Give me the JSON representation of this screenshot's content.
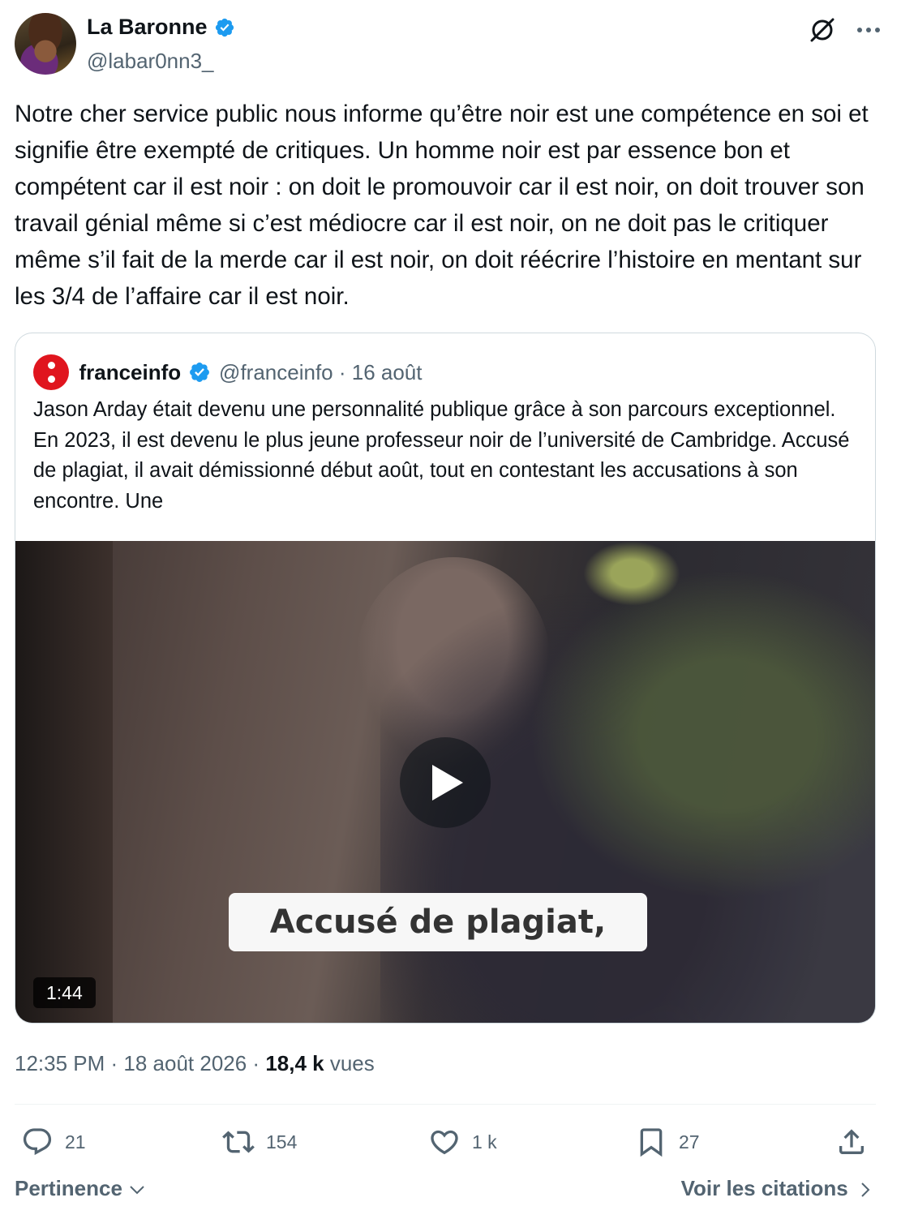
{
  "author": {
    "name": "La Baronne",
    "handle": "@labar0nn3_"
  },
  "tweet": {
    "text": "Notre cher service public nous informe qu’être noir est une compétence en soi et signifie être exempté de critiques. Un homme noir est par essence bon et compétent car il est noir : on doit le promouvoir car il est noir, on doit trouver son travail génial même si c’est médiocre car il est noir, on ne doit pas le critiquer même s’il fait de la merde car il est noir, on doit réécrire l’histoire en mentant sur les 3/4 de l’affaire car il est noir."
  },
  "quote": {
    "name": "franceinfo",
    "handle_date": "@franceinfo · 16 août",
    "text": "Jason Arday était devenu une personnalité publique grâce à son parcours exceptionnel. En 2023, il est devenu le plus jeune professeur noir de l’université de Cambridge. Accusé de plagiat, il avait démissionné début août, tout en contestant les accusations à son encontre. Une",
    "video": {
      "caption": "Accusé de plagiat,",
      "duration": "1:44"
    }
  },
  "meta": {
    "time_date": "12:35 PM · 18 août 2026 · ",
    "views_count": "18,4 k",
    "views_label": " vues"
  },
  "actions": {
    "replies": "21",
    "reposts": "154",
    "likes": "1 k",
    "bookmarks": "27"
  },
  "footer": {
    "sort_label": "Pertinence",
    "quotes_link": "Voir les citations"
  },
  "colors": {
    "verified": "#1d9bf0",
    "franceinfo_red": "#e0151e",
    "muted_text": "#536471"
  }
}
